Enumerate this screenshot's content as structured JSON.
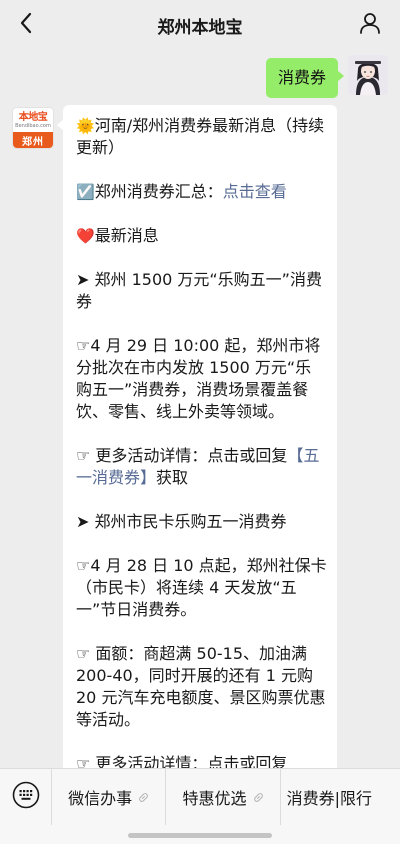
{
  "header": {
    "title": "郑州本地宝",
    "back_icon": "chevron-left-icon",
    "profile_icon": "person-icon"
  },
  "messages": {
    "user_message": "消费券",
    "bot_avatar": {
      "logo_name": "本地宝",
      "logo_url": "Bendibao.com",
      "city": "郑州"
    },
    "bot_reply": {
      "title_emoji": "🌞",
      "title": "河南/郑州消费券最新消息（持续更新）",
      "summary_emoji": "☑️",
      "summary_label": "郑州消费券汇总：",
      "summary_link": "点击查看",
      "news_emoji": "❤️",
      "news_label": "最新消息",
      "item1_heading": "➤ 郑州 1500 万元“乐购五一”消费券",
      "item1_body": "☞4 月 29 日 10:00 起，郑州市将分批次在市内发放 1500 万元“乐购五一”消费券，消费场景覆盖餐饮、零售、线上外卖等领域。",
      "item1_more_prefix": "☞ 更多活动详情：点击或回复",
      "item1_more_link": "【五一消费券】",
      "item1_more_suffix": "获取",
      "item2_heading": "➤ 郑州市民卡乐购五一消费券",
      "item2_body": "☞4 月 28 日 10 点起，郑州社保卡（市民卡）将连续 4 天发放“五一”节日消费券。",
      "item2_amount": "☞ 面额：商超满 50-15、加油满 200-40，同时开展的还有 1 元购 20 元汽车充电额度、景区购票优惠等活动。",
      "item2_more": "☞ 更多活动详情：点击或回复"
    }
  },
  "bottom_menu": {
    "keyboard_icon": "keyboard-icon",
    "items": [
      {
        "label": "微信办事"
      },
      {
        "label": "特惠优选"
      },
      {
        "label": "消费券|限行"
      }
    ]
  },
  "colors": {
    "background": "#ededed",
    "my_bubble": "#95ec69",
    "link": "#576b95",
    "brand_orange": "#e95b1d"
  }
}
